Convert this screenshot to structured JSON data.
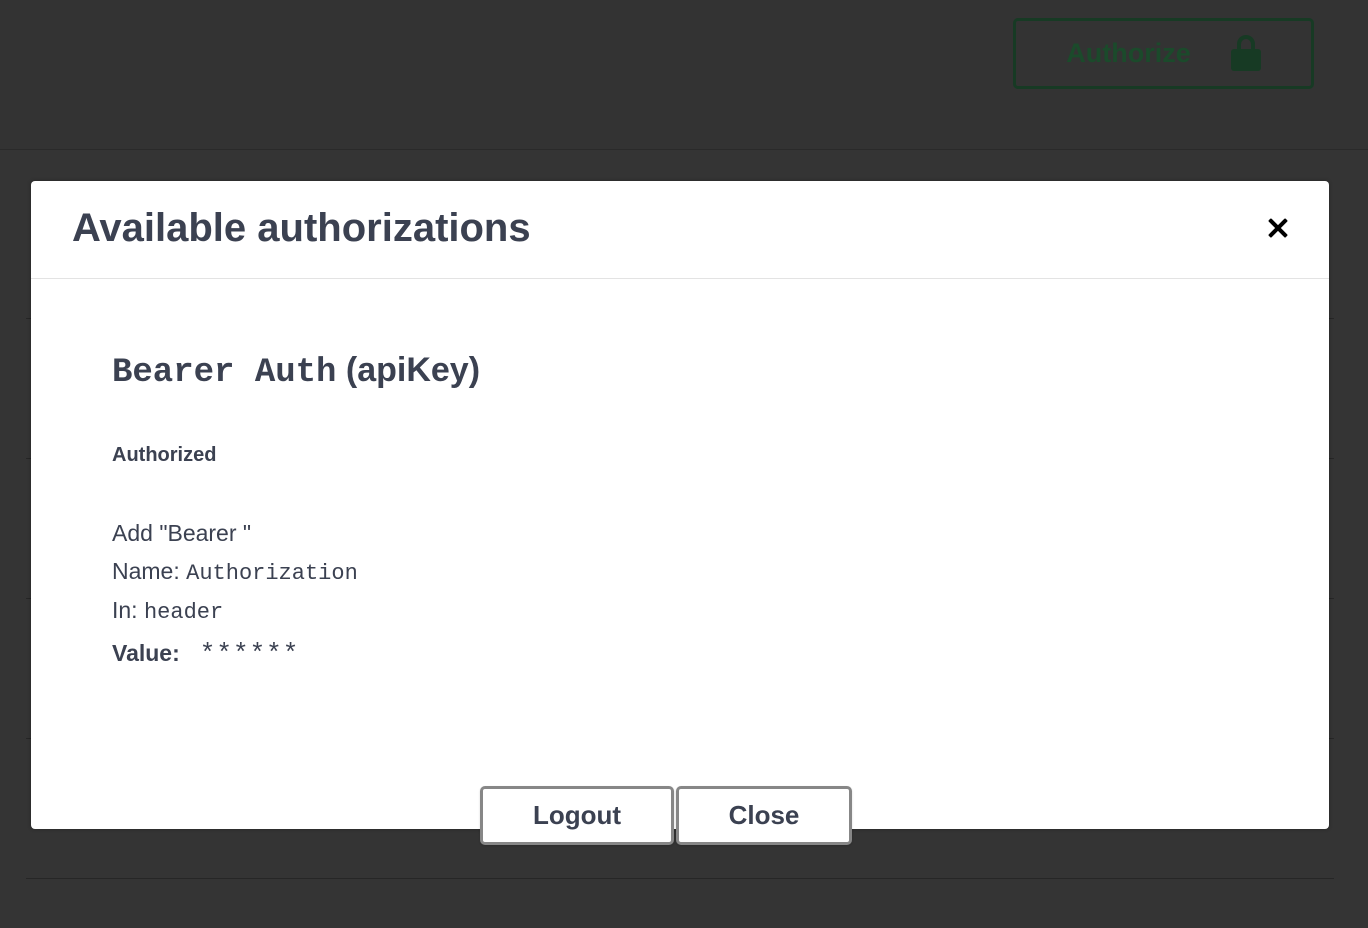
{
  "topbar": {
    "authorize_label": "Authorize",
    "authorize_icon": "lock-icon"
  },
  "modal": {
    "title": "Available authorizations",
    "close_icon": "close-icon",
    "scheme": {
      "name": "Bearer Auth",
      "type": "(apiKey)",
      "status": "Authorized",
      "description": "Add \"Bearer \"",
      "name_label": "Name:",
      "name_value": "Authorization",
      "in_label": "In:",
      "in_value": "header",
      "value_label": "Value:",
      "value_masked": "******"
    },
    "buttons": {
      "logout": "Logout",
      "close": "Close"
    }
  },
  "colors": {
    "overlay": "#333333",
    "text": "#3b4151",
    "authorize_border": "#173a24"
  }
}
